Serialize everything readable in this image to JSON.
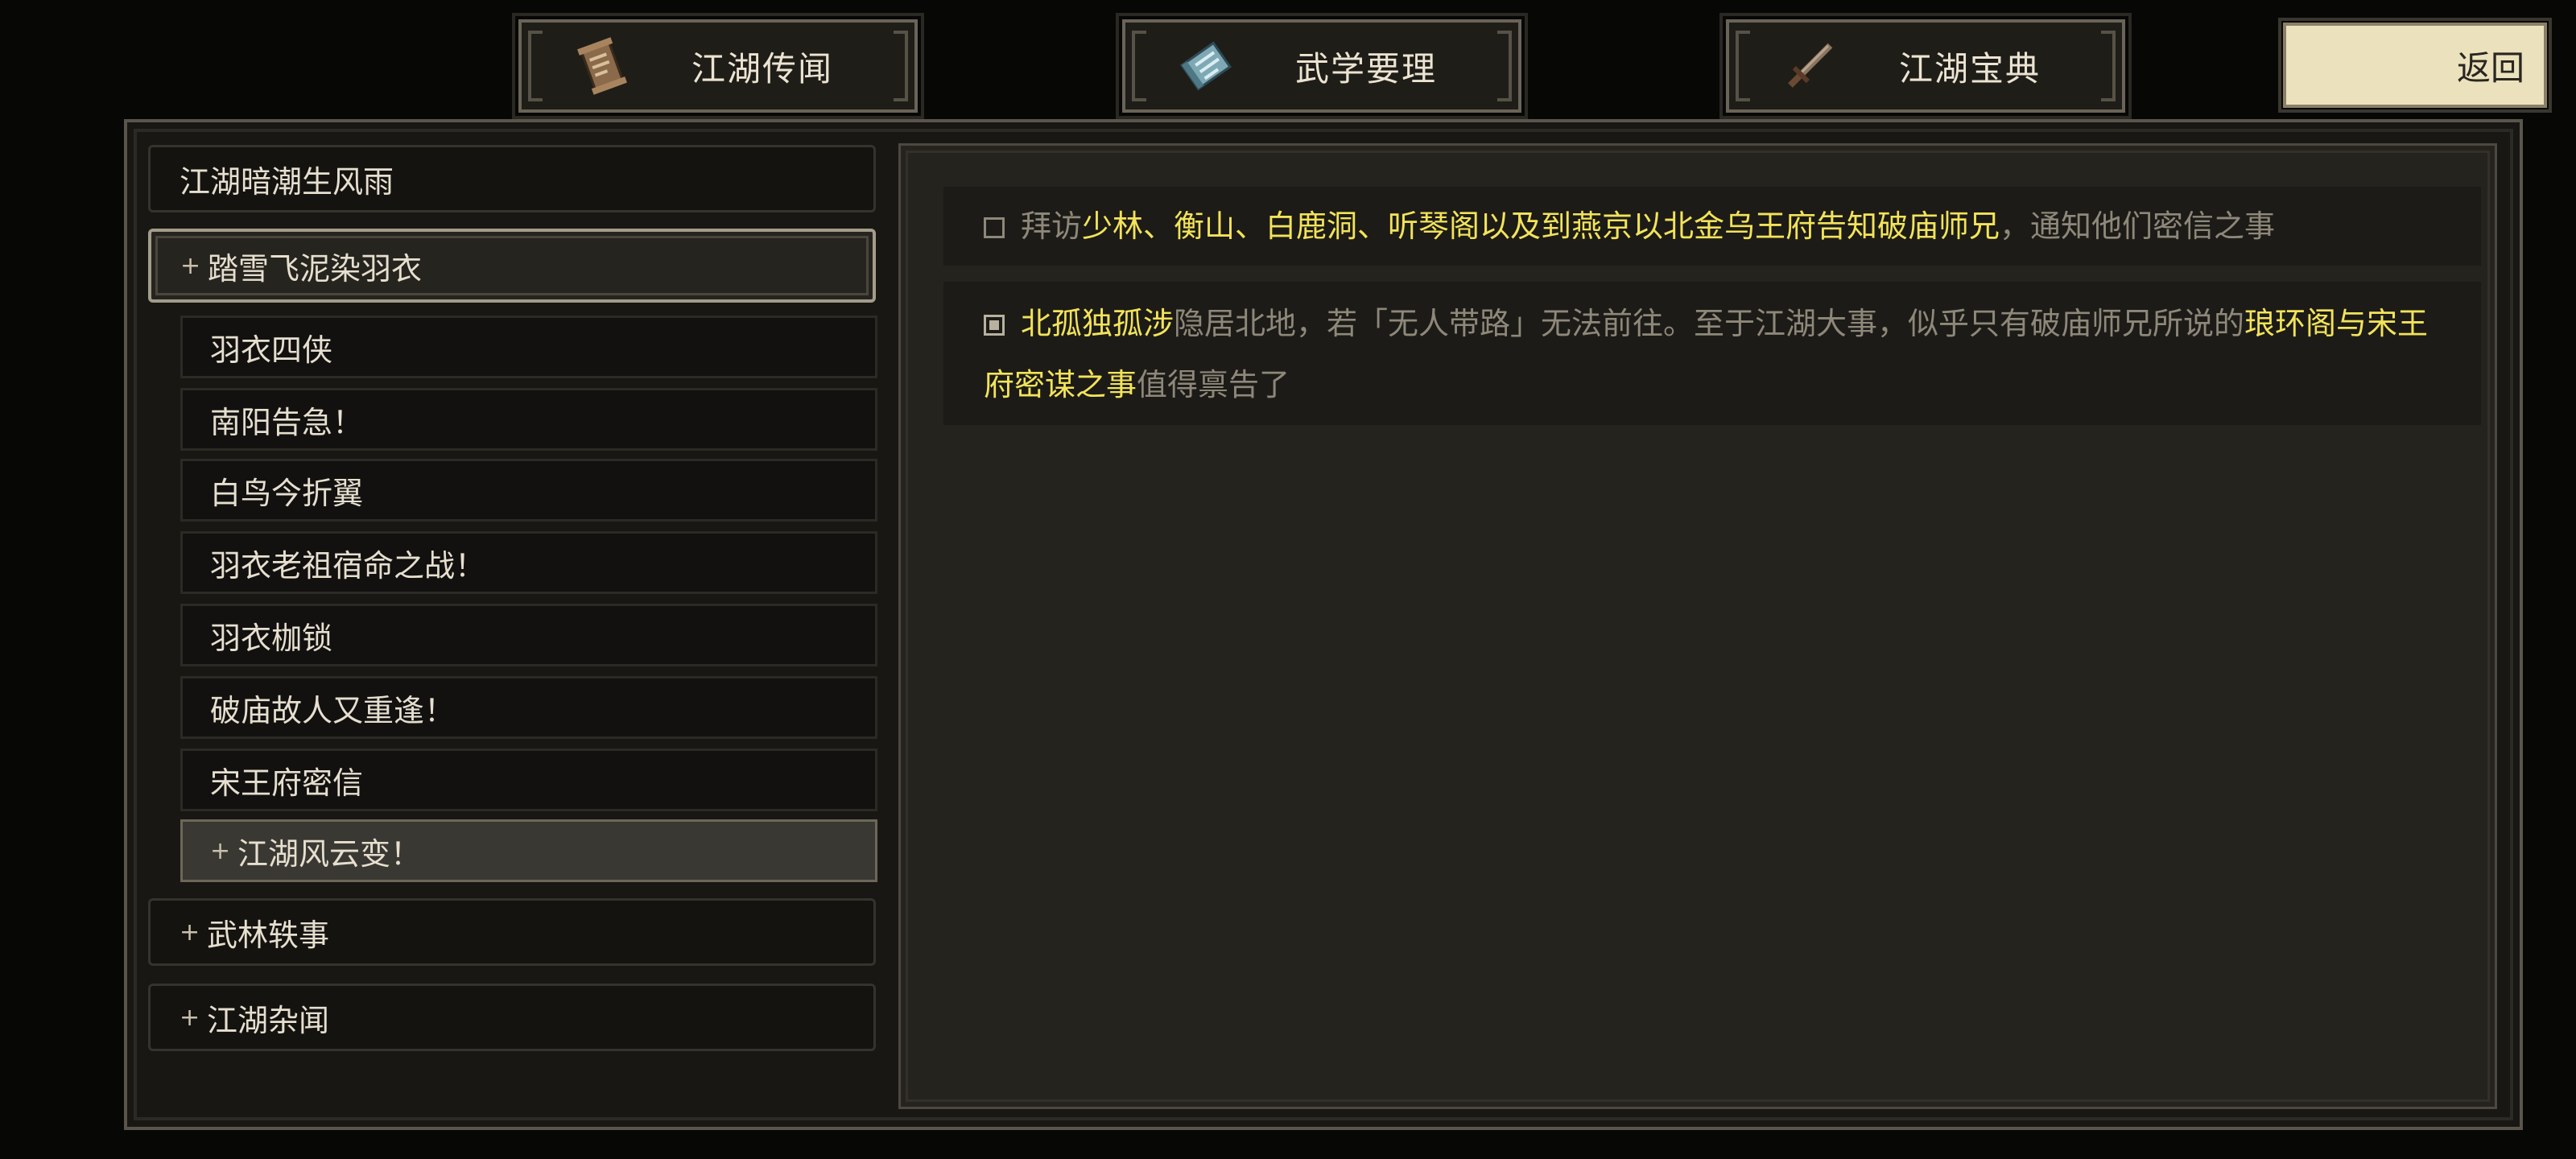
{
  "tabs": [
    {
      "label": "江湖传闻",
      "icon": "scroll-icon"
    },
    {
      "label": "武学要理",
      "icon": "manual-icon"
    },
    {
      "label": "江湖宝典",
      "icon": "sword-icon"
    }
  ],
  "back_label": "返回",
  "sidebar": {
    "categories": [
      {
        "label": "江湖暗潮生风雨",
        "expanded": false,
        "has_plus": false
      },
      {
        "label": "踏雪飞泥染羽衣",
        "expanded": true,
        "has_plus": true
      },
      {
        "label": "武林轶事",
        "expanded": false,
        "has_plus": true
      },
      {
        "label": "江湖杂闻",
        "expanded": false,
        "has_plus": true
      }
    ],
    "plus_symbol": "+",
    "subitems": [
      {
        "label": "羽衣四侠"
      },
      {
        "label": "南阳告急！"
      },
      {
        "label": "白鸟今折翼"
      },
      {
        "label": "羽衣老祖宿命之战！"
      },
      {
        "label": "羽衣枷锁"
      },
      {
        "label": "破庙故人又重逢！"
      },
      {
        "label": "宋王府密信"
      },
      {
        "label": "江湖风云变！",
        "selected": true
      }
    ]
  },
  "detail": {
    "entries": [
      {
        "done": false,
        "parts": [
          {
            "text": "拜访",
            "hl": false
          },
          {
            "text": "少林、衡山、白鹿洞、听琴阁以及到燕京以北金乌王府告知破庙师兄",
            "hl": true
          },
          {
            "text": "，通知他们密信之事",
            "hl": false
          }
        ]
      },
      {
        "done": true,
        "parts": [
          {
            "text": "北孤独孤涉",
            "hl": true
          },
          {
            "text": "隐居北地，若「无人带路」无法前往。至于江湖大事，似乎只有破庙师兄所说的",
            "hl": false
          },
          {
            "text": "琅环阁与宋王府密谋之事",
            "hl": true
          },
          {
            "text": "值得禀告了",
            "hl": false
          }
        ]
      }
    ]
  },
  "colors": {
    "highlight": "#f2e35a",
    "muted_text": "#8e887a",
    "back_button_bg": "#ebe2bd"
  }
}
